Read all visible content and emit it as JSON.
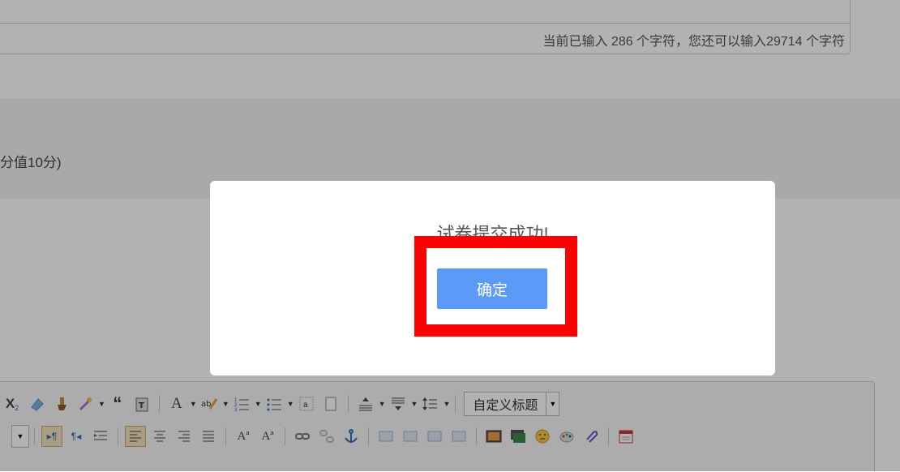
{
  "editor": {
    "char_count": "当前已输入 286 个字符，您还可以输入29714 个字符"
  },
  "question": {
    "score_text": "分值10分)"
  },
  "toolbar": {
    "custom_title": "自定义标题",
    "row1_icons": [
      "subscript-icon",
      "eraser-icon",
      "format-brush-icon",
      "magic-wand-icon",
      "quote-icon",
      "paste-text-icon",
      "font-color-icon",
      "highlight-color-icon",
      "ordered-list-icon",
      "unordered-list-icon",
      "insert-code-icon",
      "new-document-icon",
      "paragraph-spacing-top-icon",
      "paragraph-spacing-bottom-icon",
      "line-height-icon"
    ],
    "row2_icons": [
      "ltr-icon",
      "rtl-icon",
      "indent-icon",
      "align-left-icon",
      "align-center-icon",
      "align-right-icon",
      "align-justify-icon",
      "uppercase-icon",
      "lowercase-icon",
      "link-icon",
      "unlink-icon",
      "anchor-icon",
      "image-none-icon",
      "image-left-icon",
      "image-right-icon",
      "image-center-icon",
      "insert-image-icon",
      "multi-image-icon",
      "emoji-icon",
      "scrawl-icon",
      "attachment-icon",
      "date-icon"
    ]
  },
  "modal": {
    "message": "试卷提交成功!",
    "ok_label": "确定"
  },
  "colors": {
    "overlay": "rgba(0,0,0,0.30)",
    "button": "#5b9bf7",
    "highlight": "#ff0000"
  }
}
